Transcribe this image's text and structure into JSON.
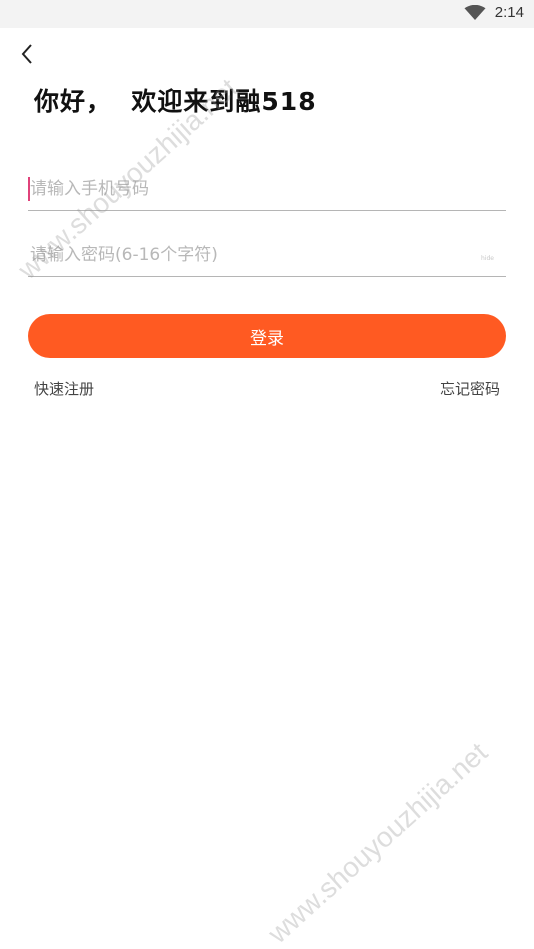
{
  "status_bar": {
    "time": "2:14",
    "wifi_icon": "wifi-icon"
  },
  "header": {
    "back_icon": "chevron-left-icon",
    "title": "你好，  欢迎来到融518"
  },
  "form": {
    "phone_placeholder": "请输入手机号码",
    "password_placeholder": "请输入密码(6-16个字符)",
    "password_toggle": "hide"
  },
  "actions": {
    "login_label": "登录",
    "register_label": "快速注册",
    "forgot_label": "忘记密码"
  },
  "watermark": {
    "top": "www.shouyouzhijia.net",
    "bottom": "www.shouyouzhijia.net"
  },
  "colors": {
    "accent": "#ff5a22",
    "cursor": "#e0427a"
  }
}
